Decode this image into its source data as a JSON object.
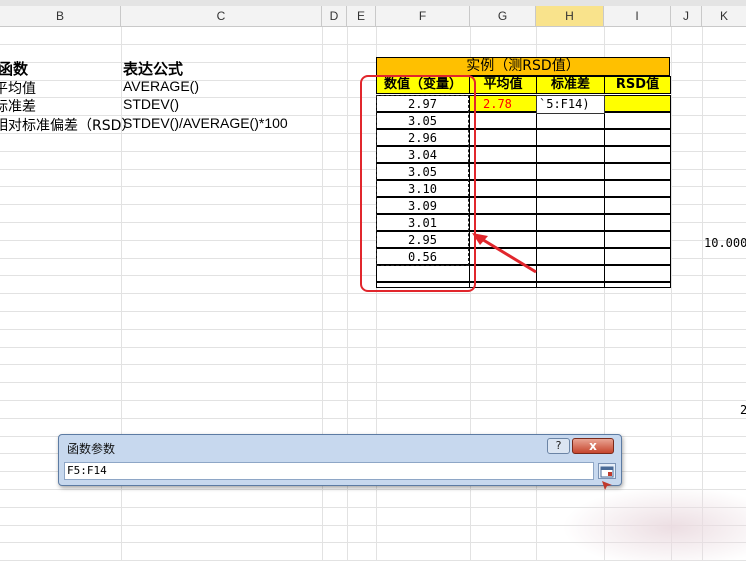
{
  "columns": [
    {
      "letter": "B",
      "selected": false
    },
    {
      "letter": "C",
      "selected": false
    },
    {
      "letter": "D",
      "selected": false
    },
    {
      "letter": "E",
      "selected": false
    },
    {
      "letter": "F",
      "selected": false
    },
    {
      "letter": "G",
      "selected": false
    },
    {
      "letter": "H",
      "selected": true
    },
    {
      "letter": "I",
      "selected": false
    },
    {
      "letter": "J",
      "selected": false
    },
    {
      "letter": "K",
      "selected": false
    }
  ],
  "left_table": {
    "header_func": "函数",
    "header_formula": "表达公式",
    "rows": [
      {
        "name": "平均值",
        "formula": "AVERAGE()"
      },
      {
        "name": "标准差",
        "formula": "STDEV()"
      },
      {
        "name": "相对标准偏差（RSD）",
        "formula": "STDEV()/AVERAGE()*100"
      }
    ]
  },
  "example": {
    "title": "实例（测RSD值）",
    "headers": [
      "数值（变量）",
      "平均值",
      "标准差",
      "RSD值"
    ],
    "values": [
      "2.97",
      "3.05",
      "2.96",
      "3.04",
      "3.05",
      "3.10",
      "3.09",
      "3.01",
      "2.95",
      "0.56"
    ],
    "average": "2.78",
    "stdev_editing": "`5:F14)"
  },
  "stray": {
    "k_value": "10.000",
    "k_value2": "2"
  },
  "dialog": {
    "title": "函数参数",
    "help": "?",
    "close": "x",
    "input": "F5:F14"
  },
  "colors": {
    "title_fill": "#ffc000",
    "header_fill": "#ffff00",
    "annotation_red": "#e1262c",
    "average_text": "#ff0000"
  }
}
